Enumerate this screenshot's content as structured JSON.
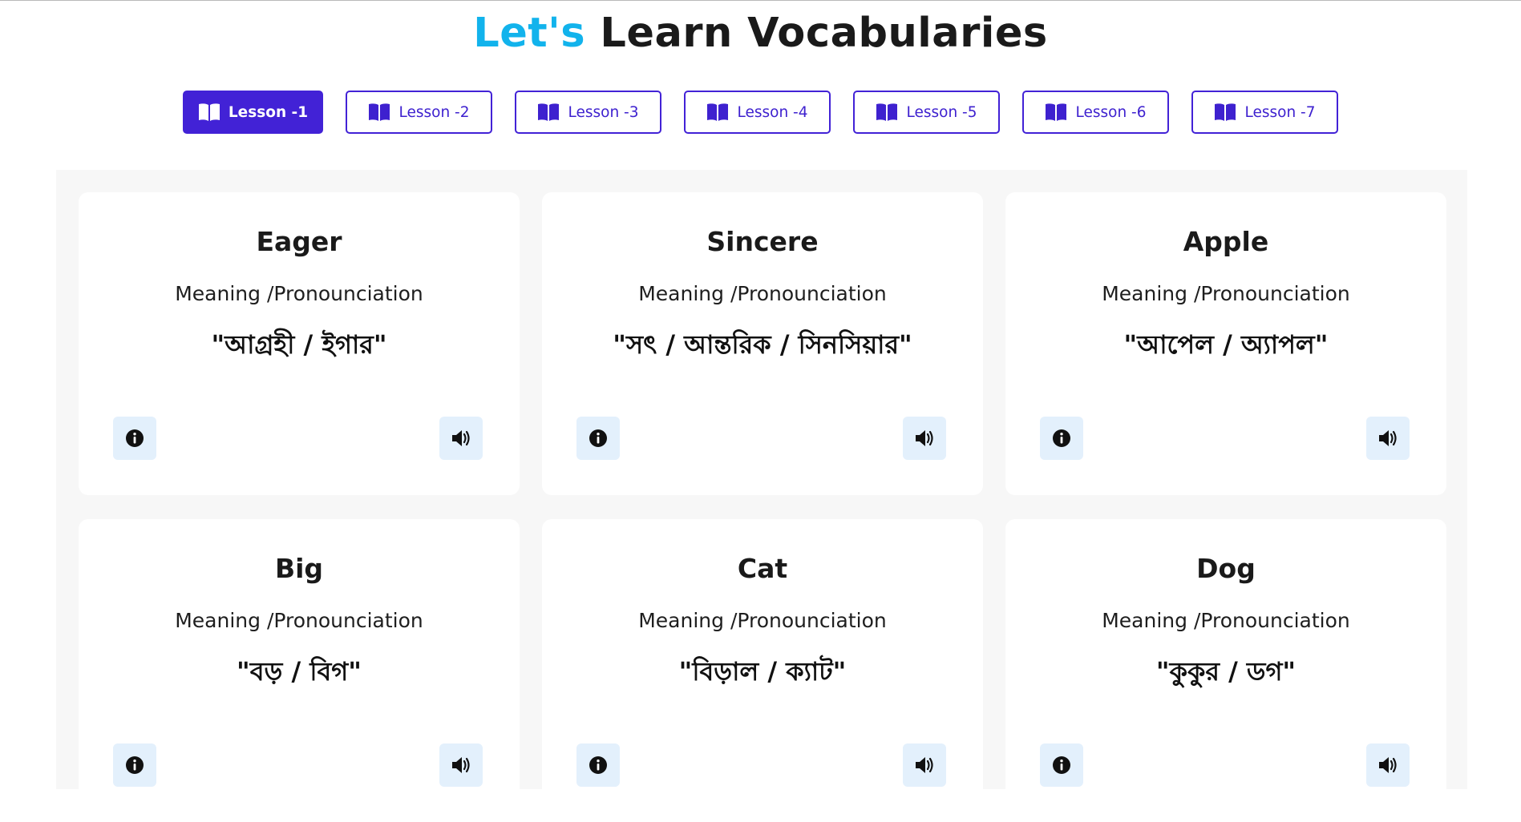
{
  "header": {
    "title_accent": "Let's",
    "title_rest": "Learn Vocabularies",
    "accent_color": "#12b3ec"
  },
  "lessons": {
    "active_index": 0,
    "brand_color": "#4222d6",
    "items": [
      {
        "label": "Lesson -1",
        "icon": "book-open-icon"
      },
      {
        "label": "Lesson -2",
        "icon": "book-open-icon"
      },
      {
        "label": "Lesson -3",
        "icon": "book-open-icon"
      },
      {
        "label": "Lesson -4",
        "icon": "book-open-icon"
      },
      {
        "label": "Lesson -5",
        "icon": "book-open-icon"
      },
      {
        "label": "Lesson -6",
        "icon": "book-open-icon"
      },
      {
        "label": "Lesson -7",
        "icon": "book-open-icon"
      }
    ]
  },
  "cards": [
    {
      "word": "Eager",
      "meaning_label": "Meaning /Pronounciation",
      "meaning": "\"আগ্রহী / ইগার\"",
      "info_icon": "info-icon",
      "audio_icon": "speaker-icon"
    },
    {
      "word": "Sincere",
      "meaning_label": "Meaning /Pronounciation",
      "meaning": "\"সৎ / আন্তরিক / সিনসিয়ার\"",
      "info_icon": "info-icon",
      "audio_icon": "speaker-icon"
    },
    {
      "word": "Apple",
      "meaning_label": "Meaning /Pronounciation",
      "meaning": "\"আপেল / অ্যাপল\"",
      "info_icon": "info-icon",
      "audio_icon": "speaker-icon"
    },
    {
      "word": "Big",
      "meaning_label": "Meaning /Pronounciation",
      "meaning": "\"বড় / বিগ\"",
      "info_icon": "info-icon",
      "audio_icon": "speaker-icon"
    },
    {
      "word": "Cat",
      "meaning_label": "Meaning /Pronounciation",
      "meaning": "\"বিড়াল / ক্যাট\"",
      "info_icon": "info-icon",
      "audio_icon": "speaker-icon"
    },
    {
      "word": "Dog",
      "meaning_label": "Meaning /Pronounciation",
      "meaning": "\"কুকুর / ডগ\"",
      "info_icon": "info-icon",
      "audio_icon": "speaker-icon"
    }
  ]
}
